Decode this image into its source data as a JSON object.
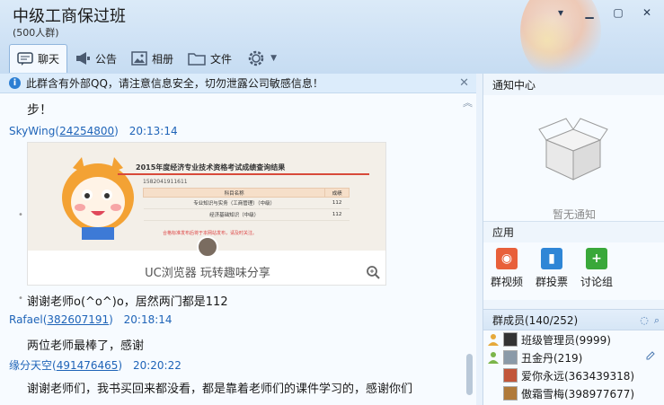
{
  "window": {
    "title": "中级工商保过班",
    "subtitle": "(500人群)",
    "buttons": [
      "minimize",
      "maximize",
      "close"
    ]
  },
  "tabs": [
    {
      "label": "聊天",
      "icon": "chat-icon",
      "active": true
    },
    {
      "label": "公告",
      "icon": "announcement-icon",
      "active": false
    },
    {
      "label": "相册",
      "icon": "photo-album-icon",
      "active": false
    },
    {
      "label": "文件",
      "icon": "folder-icon",
      "active": false
    },
    {
      "label": "",
      "icon": "settings-gear-icon",
      "active": false
    }
  ],
  "notice": {
    "text": "此群含有外部QQ，请注意信息安全，切勿泄露公司敏感信息！"
  },
  "chat": {
    "messages": [
      {
        "text": "步！"
      },
      {
        "sender": "SkyWing",
        "uid": "24254800",
        "time": "20:13:14",
        "text": "谢谢老师o(^o^)o，居然两门都是112"
      },
      {
        "sender": "Rafael",
        "uid": "382607191",
        "time": "20:18:14",
        "text": "两位老师最棒了，感谢"
      },
      {
        "sender": "缘分天空",
        "uid": "491476465",
        "time": "20:20:22",
        "text": "谢谢老师们，我书买回来都没看，都是靠着老师们的课件学习的，感谢你们"
      }
    ],
    "image": {
      "report_title": "2015年度经济专业技术资格考试成绩查询结果",
      "report_id": "1582041911611",
      "table_headers": [
        "科目名称",
        "成绩"
      ],
      "table_rows": [
        [
          "专业知识与实务（工商管理）（中级）",
          "112"
        ],
        [
          "经济基础知识（中级）",
          "112"
        ]
      ],
      "note": "合格标准发布后将于本网站发布，请及时关注。",
      "brand": "UC浏览器  玩转趣味分享"
    }
  },
  "sidebar": {
    "notify": {
      "title": "通知中心",
      "empty_text": "暂无通知"
    },
    "apps": {
      "title": "应用",
      "items": [
        {
          "label": "群视频",
          "color": "#e8603a"
        },
        {
          "label": "群投票",
          "color": "#2f86d6"
        },
        {
          "label": "讨论组",
          "color": "#3aa83a"
        }
      ]
    },
    "members": {
      "title": "群成员(140/252)",
      "items": [
        {
          "name": "班级管理员(9999)"
        },
        {
          "name": "丑金丹(219)"
        },
        {
          "name": "爱你永远(363439318)"
        },
        {
          "name": "傲霜雪梅(398977677)"
        }
      ]
    }
  }
}
